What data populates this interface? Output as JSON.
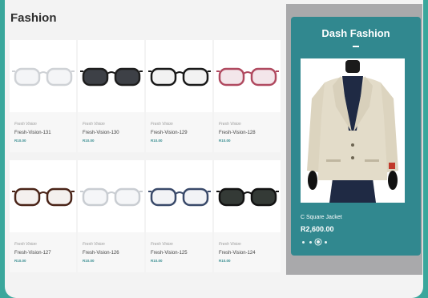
{
  "section": {
    "title": "Fashion"
  },
  "products": [
    {
      "brand": "Fresh Vision",
      "name": "Fresh-Vision-131",
      "price": "R10.00",
      "frame_color": "#cfd2d6",
      "lens_color": "#f4f5f7"
    },
    {
      "brand": "Fresh Vision",
      "name": "Fresh-Vision-130",
      "price": "R10.00",
      "frame_color": "#1e1e1e",
      "lens_color": "#3d4046"
    },
    {
      "brand": "Fresh Vision",
      "name": "Fresh-Vision-129",
      "price": "R10.00",
      "frame_color": "#1a1a1a",
      "lens_color": "#f2f2f2"
    },
    {
      "brand": "Fresh Vision",
      "name": "Fresh-Vision-128",
      "price": "R10.00",
      "frame_color": "#b04a60",
      "lens_color": "#f3e6ea"
    },
    {
      "brand": "Fresh Vision",
      "name": "Fresh-Vision-127",
      "price": "R10.00",
      "frame_color": "#4a2418",
      "lens_color": "#f4f0ee"
    },
    {
      "brand": "Fresh Vision",
      "name": "Fresh-Vision-126",
      "price": "R10.00",
      "frame_color": "#c9cdd2",
      "lens_color": "#f5f6f8"
    },
    {
      "brand": "Fresh Vision",
      "name": "Fresh-Vision-125",
      "price": "R10.00",
      "frame_color": "#3a4a6a",
      "lens_color": "#f2f3f6"
    },
    {
      "brand": "Fresh Vision",
      "name": "Fresh-Vision-124",
      "price": "R10.00",
      "frame_color": "#121212",
      "lens_color": "#343a36"
    }
  ],
  "featured": {
    "title": "Dash Fashion",
    "product_name": "C Square Jacket",
    "price": "R2,600.00",
    "slide_count": 4,
    "active_slide": 2
  },
  "colors": {
    "page_bg": "#3aa79c",
    "panel": "#31888f",
    "price": "#3a8e91"
  }
}
